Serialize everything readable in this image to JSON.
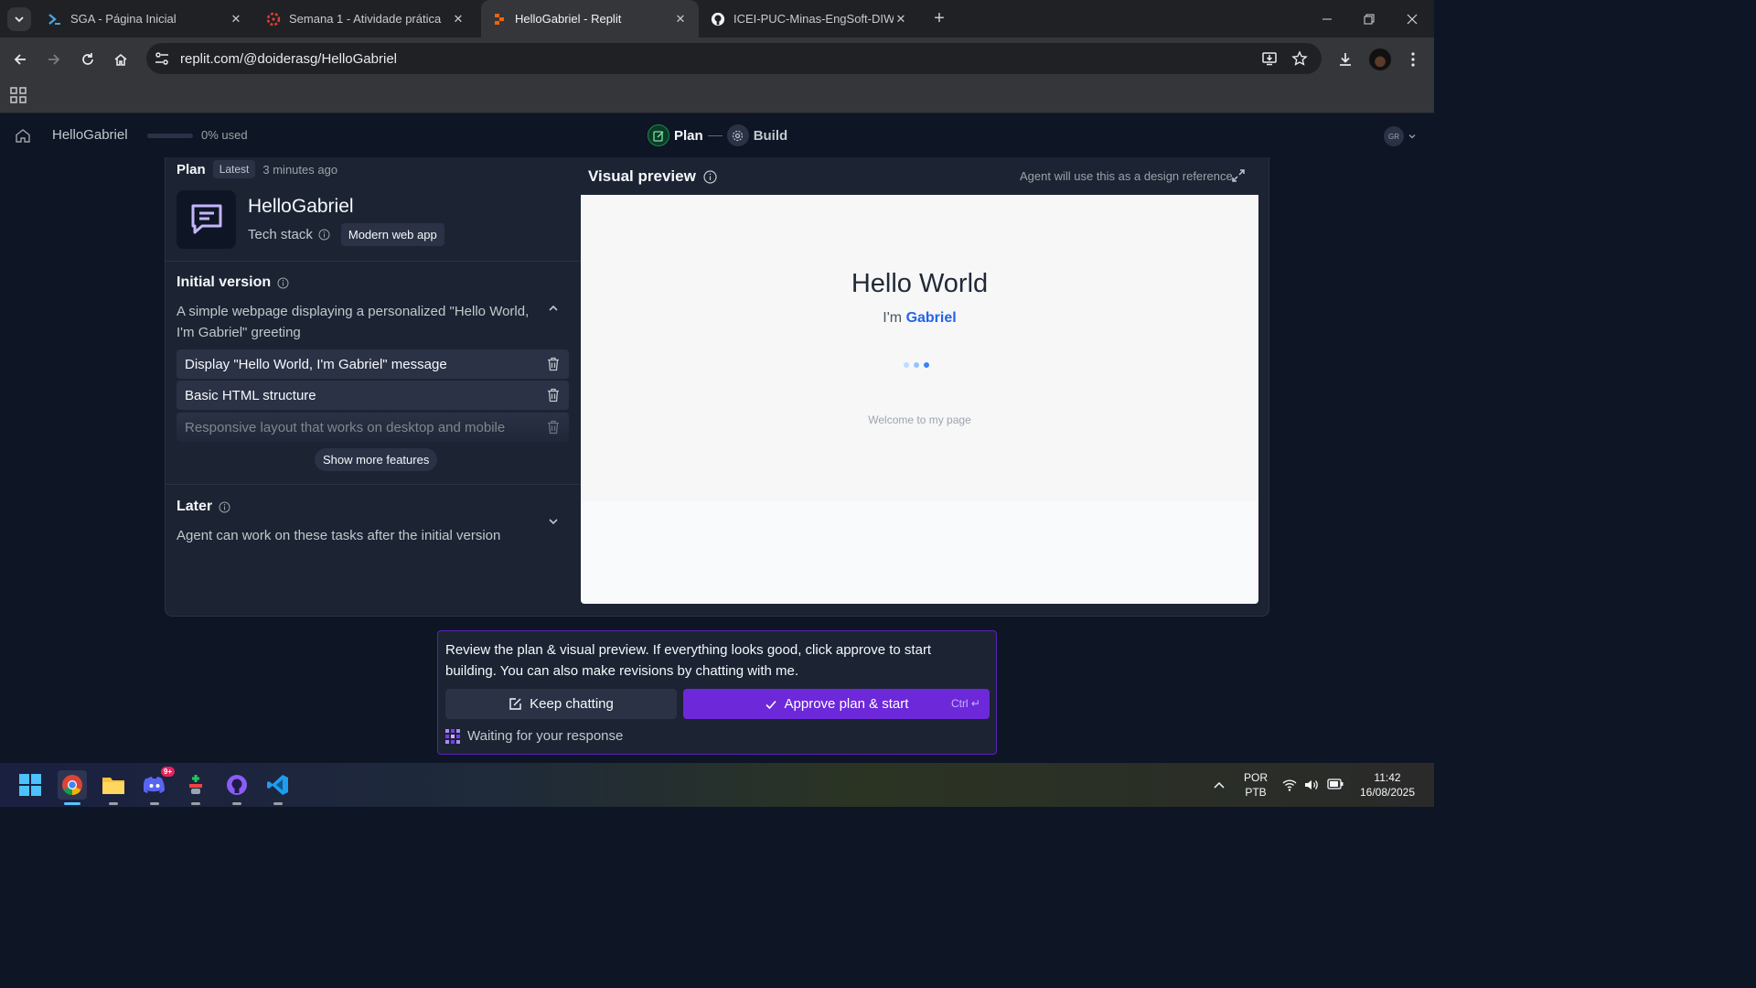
{
  "browser": {
    "tabs": [
      {
        "title": "SGA - Página Inicial",
        "active": false
      },
      {
        "title": "Semana 1 - Atividade prática",
        "active": false
      },
      {
        "title": "HelloGabriel - Replit",
        "active": true
      },
      {
        "title": "ICEI-PUC-Minas-EngSoft-DIW/t",
        "active": false
      }
    ],
    "url": "replit.com/@doiderasg/HelloGabriel"
  },
  "header": {
    "project_name": "HelloGabriel",
    "usage_text": "0% used",
    "usage_fraction": 0,
    "steps": [
      {
        "label": "Plan",
        "state": "active"
      },
      {
        "label": "Build",
        "state": "inactive"
      }
    ],
    "avatar_initials": "GR"
  },
  "plan": {
    "title": "Plan",
    "badge": "Latest",
    "time": "3 minutes ago",
    "app_name": "HelloGabriel",
    "tech_stack_label": "Tech stack",
    "tech_stack_value": "Modern web app",
    "initial_version": {
      "title": "Initial version",
      "description": "A simple webpage displaying a personalized \"Hello World, I'm Gabriel\" greeting",
      "features": [
        "Display \"Hello World, I'm Gabriel\" message",
        "Basic HTML structure",
        "Responsive layout that works on desktop and mobile"
      ],
      "show_more_label": "Show more features"
    },
    "later": {
      "title": "Later",
      "description": "Agent can work on these tasks after the initial version"
    }
  },
  "preview": {
    "title": "Visual preview",
    "reference_note": "Agent will use this as a design reference",
    "page": {
      "heading": "Hello World",
      "im_prefix": "I'm",
      "name": "Gabriel",
      "welcome": "Welcome to my page"
    }
  },
  "approval": {
    "message": "Review the plan & visual preview. If everything looks good, click approve to start building. You can also make revisions by chatting with me.",
    "keep_chatting_label": "Keep chatting",
    "approve_label": "Approve plan & start",
    "shortcut": "Ctrl ↵",
    "status": "Waiting for your response"
  },
  "taskbar": {
    "discord_badge": "9+",
    "lang_top": "POR",
    "lang_bottom": "PTB",
    "time": "11:42",
    "date": "16/08/2025"
  },
  "colors": {
    "accent_purple": "#6d28d9",
    "plan_green": "#1f8a4c",
    "preview_blue": "#2563eb",
    "replit_bg": "#0e1525",
    "panel_bg": "#1c2333"
  }
}
